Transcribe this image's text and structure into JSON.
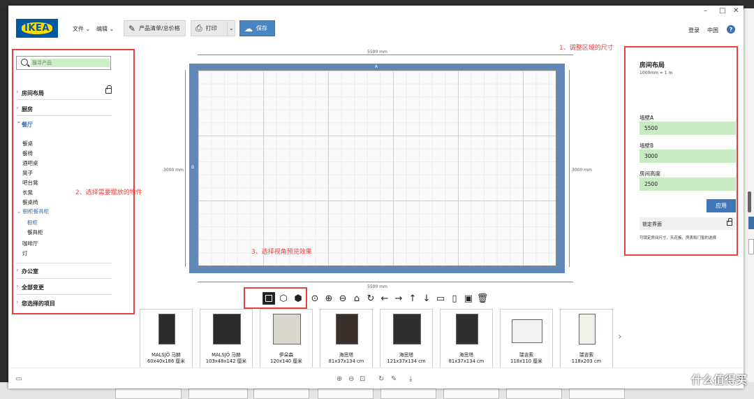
{
  "window": {
    "minimize": "–",
    "maximize": "□",
    "close": "✕"
  },
  "toolbar": {
    "logo": "IKEA",
    "menu_file": "文件",
    "menu_edit": "编辑",
    "product_list": "产品清单/总价格",
    "print": "打印",
    "save": "保存",
    "login": "登录",
    "region": "中国",
    "help": "?"
  },
  "search": {
    "placeholder": "搜寻产品"
  },
  "categories": {
    "room_layout": "房间布局",
    "kitchen": "厨房",
    "dining": "餐厅",
    "office": "办公室",
    "all_change": "全部变更",
    "selected": "您选择的项目"
  },
  "dining_items": [
    "餐桌",
    "餐椅",
    "酒吧桌",
    "凳子",
    "吧台凳",
    "长凳",
    "餐桌椅",
    "橱柜餐具柜",
    "橱柜",
    "餐具柜",
    "咖啡厅",
    "灯"
  ],
  "canvas": {
    "wall_a_length": "5500 mm",
    "wall_b_length": "3000 mm",
    "wall_a": "A",
    "wall_b": "B",
    "bottom_length": "5500 mm",
    "right_length": "3000 mm"
  },
  "annotations": {
    "a1": "1、调整区域的尺寸",
    "a2": "2、选择需要摆放的物件",
    "a3": "3、选择视角预览效果"
  },
  "products": [
    {
      "name": "MALSJÖ 马赫",
      "size": "60x40x186 厘米"
    },
    {
      "name": "MALSJÖ 马赫",
      "size": "103x48x142 厘米"
    },
    {
      "name": "伊朵森",
      "size": "120x140 厘米"
    },
    {
      "name": "海思塔",
      "size": "81x37x134 cm"
    },
    {
      "name": "海思塔",
      "size": "121x37x134 cm"
    },
    {
      "name": "海思塔",
      "size": "81x37x134 cm"
    },
    {
      "name": "瑞吉索",
      "size": "118x110 厘米"
    },
    {
      "name": "瑞吉索",
      "size": "118x203 cm"
    }
  ],
  "right_panel": {
    "title": "房间布局",
    "scale": "1000mm = 1 m",
    "wall_a_label": "墙壁A",
    "wall_a_value": "5500",
    "wall_b_label": "墙壁B",
    "wall_b_value": "3000",
    "height_label": "房间高度",
    "height_value": "2500",
    "apply": "应用",
    "lock_label": "锁定界面",
    "lock_hint": "可锁定房间尺寸、天花板、房表和门窗的选择"
  },
  "watermark": {
    "logo": "值",
    "text": "什么值得买"
  },
  "colors": {
    "accent": "#3f77b8",
    "wall": "#5f88b8",
    "annotation": "#e8423d",
    "field": "#c7ecc3"
  }
}
